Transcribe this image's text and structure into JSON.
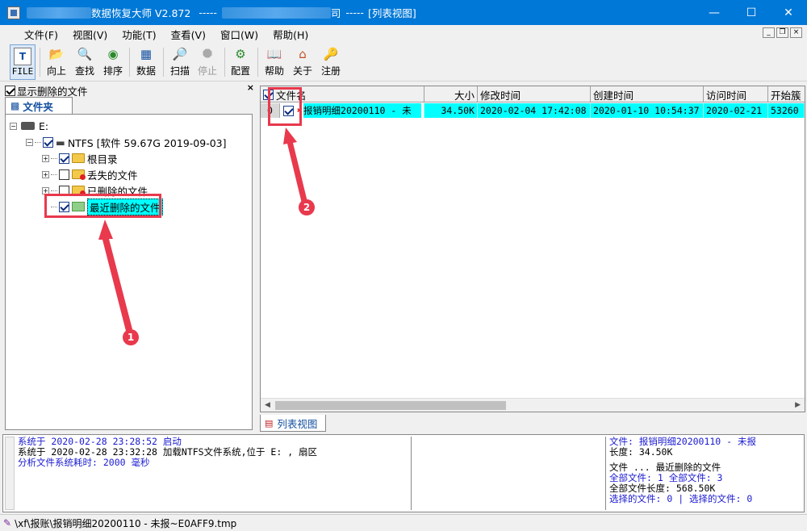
{
  "window": {
    "title_prefix": "数据恢复大师 V2.872",
    "title_sep1": "-----",
    "title_company_suffix": "司",
    "title_sep2": "-----",
    "title_view": "[列表视图]"
  },
  "menu": [
    "文件(F)",
    "视图(V)",
    "功能(T)",
    "查看(V)",
    "窗口(W)",
    "帮助(H)"
  ],
  "toolbar": {
    "file": "FILE",
    "up": "向上",
    "find": "查找",
    "sort": "排序",
    "data": "数据",
    "scan": "扫描",
    "stop": "停止",
    "config": "配置",
    "help": "帮助",
    "about": "关于",
    "register": "注册"
  },
  "left": {
    "show_deleted": "显示删除的文件",
    "folder_tab": "文件夹",
    "tree": {
      "drive": "E:",
      "partition": "NTFS [软件 59.67G 2019-09-03]",
      "root": "根目录",
      "lost": "丢失的文件",
      "deleted": "已删除的文件",
      "recent": "最近删除的文件"
    }
  },
  "grid": {
    "headers": [
      "文件名",
      "大小",
      "修改时间",
      "创建时间",
      "访问时间",
      "开始簇"
    ],
    "row": {
      "index": "0",
      "name": "报销明细20200110 - 未",
      "size": "34.50K",
      "modified": "2020-02-04 17:42:08",
      "created": "2020-01-10 10:54:37",
      "accessed": "2020-02-21",
      "start": "53260"
    }
  },
  "listview_tab": "列表视图",
  "log": [
    {
      "text": "系统于 2020-02-28 23:28:52 启动",
      "color": "#1a1ad0"
    },
    {
      "text": "系统于 2020-02-28 23:32:28 加载NTFS文件系统,位于 E: ,    扇区",
      "color": "#000000"
    },
    {
      "text": "分析文件系统耗时: 2000 毫秒",
      "color": "#1a1ad0"
    }
  ],
  "info": {
    "file": "文件: 报销明细20200110 - 未报",
    "length": "长度: 34.50K",
    "category": "文件 ... 最近删除的文件",
    "all_files": "全部文件: 1 全部文件: 3",
    "total_len": "全部文件长度: 568.50K",
    "selected": "选择的文件: 0 | 选择的文件: 0"
  },
  "status": "\\xf\\报账\\报销明细20200110 - 未报~E0AFF9.tmp",
  "annotations": {
    "one": "1",
    "two": "2"
  },
  "colors": {
    "titlebar": "#0078d7",
    "selection": "#00ffff",
    "annotation": "#e8394d"
  }
}
